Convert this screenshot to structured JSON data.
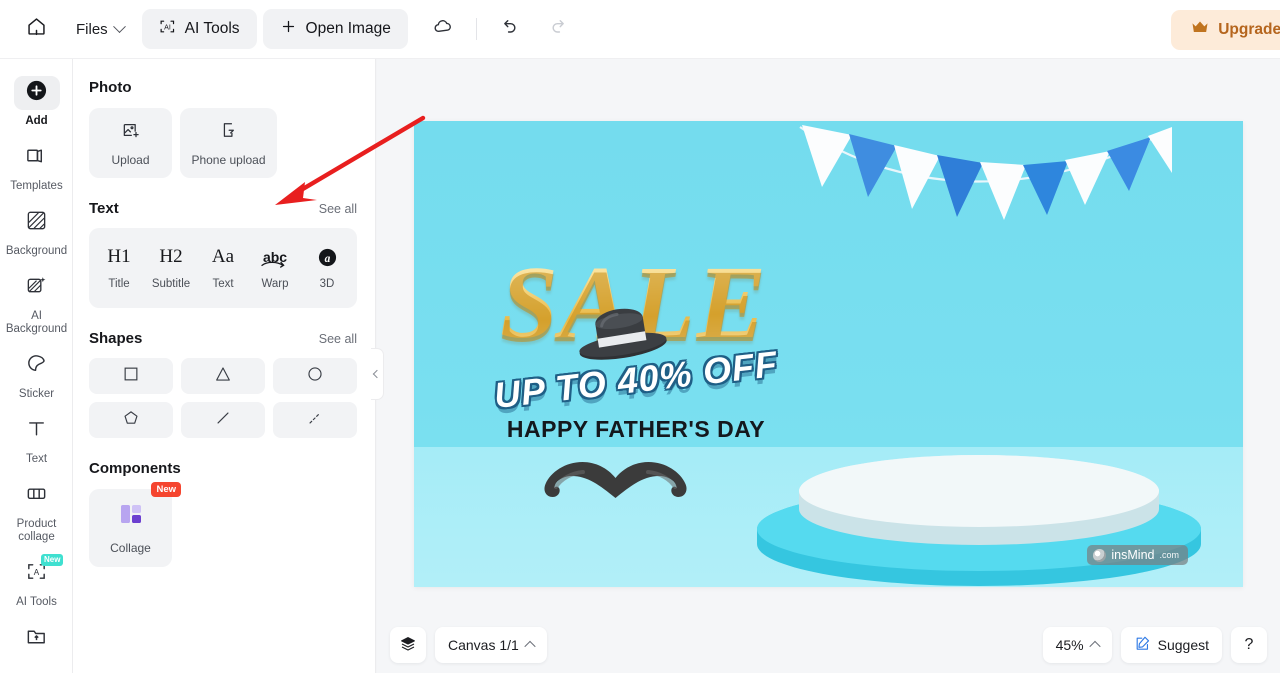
{
  "app": {
    "brand": "insMind",
    "watermark": "insMind",
    "watermark_tld": ".com"
  },
  "topbar": {
    "home_icon": "home-icon",
    "files_label": "Files",
    "ai_tools_label": "AI Tools",
    "open_image_label": "Open Image",
    "cloud_icon": "cloud-save-icon",
    "undo_icon": "undo-icon",
    "redo_icon": "redo-icon",
    "upgrade_label": "Upgrade to",
    "upgrade_icon": "crown-icon",
    "upgrade_bg": "#fdebd9",
    "upgrade_color": "#b5651d"
  },
  "rail": {
    "items": [
      {
        "label": "Add",
        "icon": "plus-circle-icon",
        "active": true,
        "badge": ""
      },
      {
        "label": "Templates",
        "icon": "templates-icon",
        "active": false,
        "badge": ""
      },
      {
        "label": "Background",
        "icon": "background-icon",
        "active": false,
        "badge": ""
      },
      {
        "label": "AI\nBackground",
        "icon": "ai-background-icon",
        "active": false,
        "badge": ""
      },
      {
        "label": "Sticker",
        "icon": "sticker-icon",
        "active": false,
        "badge": ""
      },
      {
        "label": "Text",
        "icon": "text-icon",
        "active": false,
        "badge": ""
      },
      {
        "label": "Product\ncollage",
        "icon": "product-collage-icon",
        "active": false,
        "badge": ""
      },
      {
        "label": "AI Tools",
        "icon": "ai-tools-icon",
        "active": false,
        "badge": "New"
      }
    ],
    "badge_color": "#3fe0d0"
  },
  "panel": {
    "photo": {
      "title": "Photo",
      "cards": [
        {
          "label": "Upload",
          "icon": "image-upload-icon"
        },
        {
          "label": "Phone upload",
          "icon": "phone-upload-icon"
        }
      ]
    },
    "text": {
      "title": "Text",
      "see_all": "See all",
      "tools": [
        {
          "glyph": "H1",
          "label": "Title",
          "icon": "heading-1-icon"
        },
        {
          "glyph": "H2",
          "label": "Subtitle",
          "icon": "heading-2-icon"
        },
        {
          "glyph": "Aa",
          "label": "Text",
          "icon": "text-aa-icon"
        },
        {
          "glyph": "abc",
          "label": "Warp",
          "icon": "warp-text-icon"
        },
        {
          "glyph": "3D",
          "label": "3D",
          "icon": "text-3d-icon"
        }
      ]
    },
    "shapes": {
      "title": "Shapes",
      "see_all": "See all",
      "items": [
        {
          "name": "square-shape"
        },
        {
          "name": "triangle-shape"
        },
        {
          "name": "circle-shape"
        },
        {
          "name": "pentagon-shape"
        },
        {
          "name": "line-shape"
        },
        {
          "name": "dashed-line-shape"
        }
      ]
    },
    "components": {
      "title": "Components",
      "card_label": "Collage",
      "badge": "New",
      "badge_color": "#f5452f"
    }
  },
  "canvas": {
    "headline": "SALE",
    "subhead": "UP TO 40% OFF",
    "tagline": "HAPPY FATHER'S DAY",
    "bg_color": "#77dfef",
    "floor_color": "#aceef8",
    "gold_color": "#e8b948",
    "outline_color": "#1f5f86"
  },
  "bottombar": {
    "layers_icon": "layers-icon",
    "canvas_label": "Canvas 1/1",
    "zoom_label": "45%",
    "suggest_label": "Suggest",
    "suggest_icon": "suggest-edit-icon",
    "help_label": "?"
  },
  "annotation": {
    "arrow_color": "#e81f1f",
    "points_at": "Text"
  }
}
